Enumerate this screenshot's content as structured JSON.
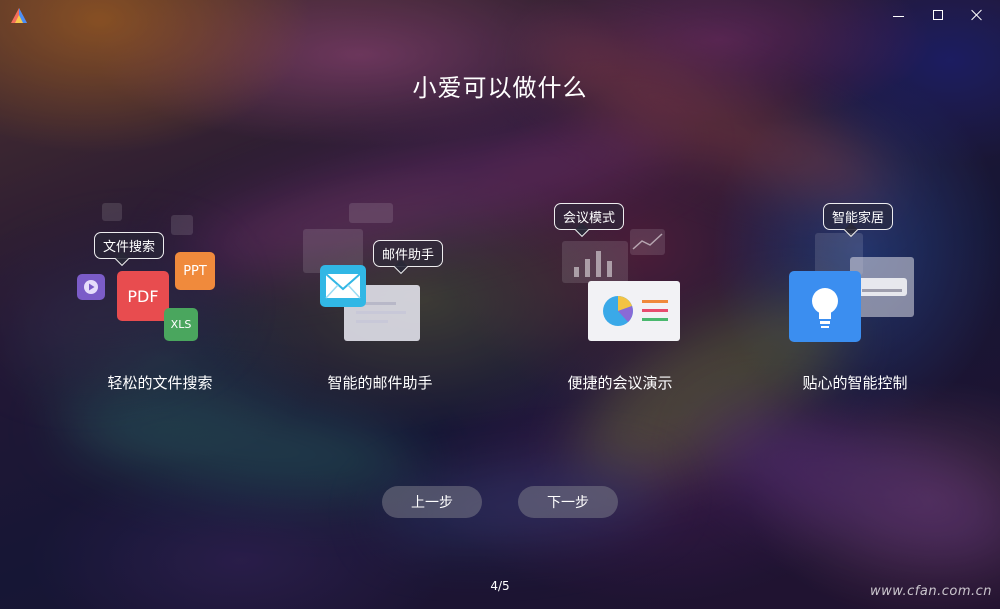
{
  "window": {
    "controls": [
      "minimize",
      "maximize",
      "close"
    ]
  },
  "colors": {
    "pdf": "#e84c4f",
    "ppt": "#f08a3c",
    "xls": "#4aa65e",
    "play": "#7b5cc8",
    "mail": "#31b7e5",
    "bulb": "#3b8ef0"
  },
  "page": {
    "title": "小爱可以做什么"
  },
  "features": [
    {
      "label": "轻松的文件搜索",
      "bubble": "文件搜索",
      "tiles": {
        "pdf": "PDF",
        "ppt": "PPT",
        "xls": "XLS"
      }
    },
    {
      "label": "智能的邮件助手",
      "bubble": "邮件助手"
    },
    {
      "label": "便捷的会议演示",
      "bubble": "会议模式"
    },
    {
      "label": "贴心的智能控制",
      "bubble": "智能家居"
    }
  ],
  "nav": {
    "prev": "上一步",
    "next": "下一步"
  },
  "pager": "4/5",
  "watermark": "www.cfan.com.cn"
}
